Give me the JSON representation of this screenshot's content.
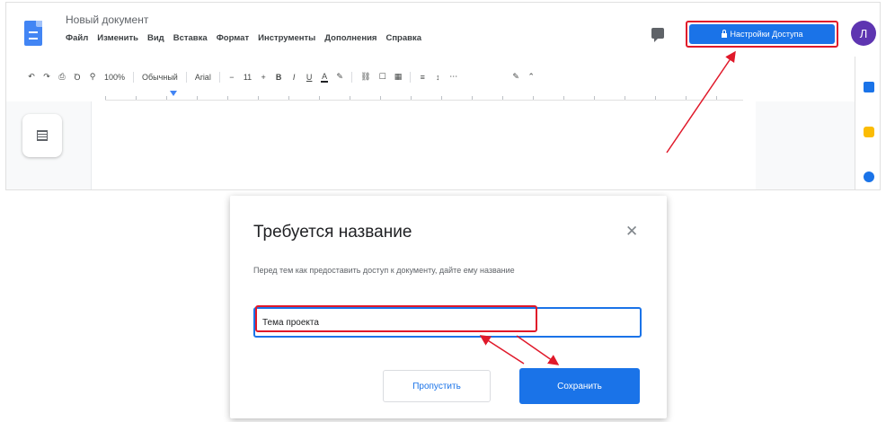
{
  "docs": {
    "document_title": "Новый документ",
    "menu": [
      "Файл",
      "Изменить",
      "Вид",
      "Вставка",
      "Формат",
      "Инструменты",
      "Дополнения",
      "Справка"
    ],
    "share_button_label": "Настройки Доступа",
    "avatar_initial": "Л",
    "toolbar": {
      "undo": "↶",
      "redo": "↷",
      "print": "⎙",
      "spellcheck": "Ꝺ",
      "paint_format": "⚲",
      "zoom": "100%",
      "style": "Обычный",
      "font": "Arial",
      "font_size": "11",
      "decrease": "−",
      "increase": "+",
      "bold": "B",
      "italic": "I",
      "underline": "U",
      "text_color": "A",
      "highlight": "✎",
      "link": "⛓",
      "comment": "☐",
      "image": "▦",
      "align": "≡",
      "line_spacing": "↕",
      "more": "⋯",
      "edit_mode": "✎",
      "collapse": "⌃"
    },
    "colors": {
      "accent": "#1a73e8",
      "highlight_frame": "#e0192a"
    }
  },
  "dialog": {
    "title": "Требуется название",
    "close_glyph": "✕",
    "description": "Перед тем как предоставить доступ к документу, дайте ему название",
    "input_value": "Тема проекта",
    "skip_label": "Пропустить",
    "save_label": "Сохранить"
  }
}
